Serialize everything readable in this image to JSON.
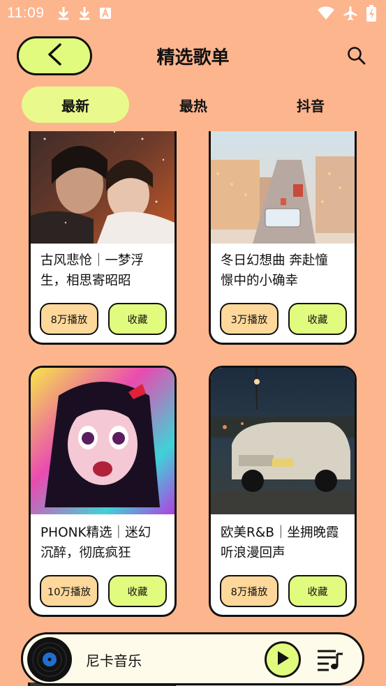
{
  "status": {
    "time": "11:09"
  },
  "header": {
    "title": "精选歌单"
  },
  "tabs": [
    {
      "label": "最新",
      "active": true
    },
    {
      "label": "最热",
      "active": false
    },
    {
      "label": "抖音",
      "active": false
    }
  ],
  "cards": [
    {
      "title_line1": "古风悲怆｜一梦浮",
      "title_line2": "生，相思寄昭昭",
      "plays": "8万播放",
      "fav": "收藏"
    },
    {
      "title_line1": "冬日幻想曲 奔赴憧",
      "title_line2": "憬中的小确幸",
      "plays": "3万播放",
      "fav": "收藏"
    },
    {
      "title_line1": "PHONK精选｜迷幻",
      "title_line2": "沉醉，彻底疯狂",
      "plays": "10万播放",
      "fav": "收藏"
    },
    {
      "title_line1": "欧美R&B｜坐拥晚霞",
      "title_line2": "听浪漫回声",
      "plays": "8万播放",
      "fav": "收藏"
    }
  ],
  "player": {
    "name": "尼卡音乐"
  },
  "colors": {
    "background": "#FDB58E",
    "accent": "#E1FB7E",
    "plays_pill": "#FDD89A"
  }
}
